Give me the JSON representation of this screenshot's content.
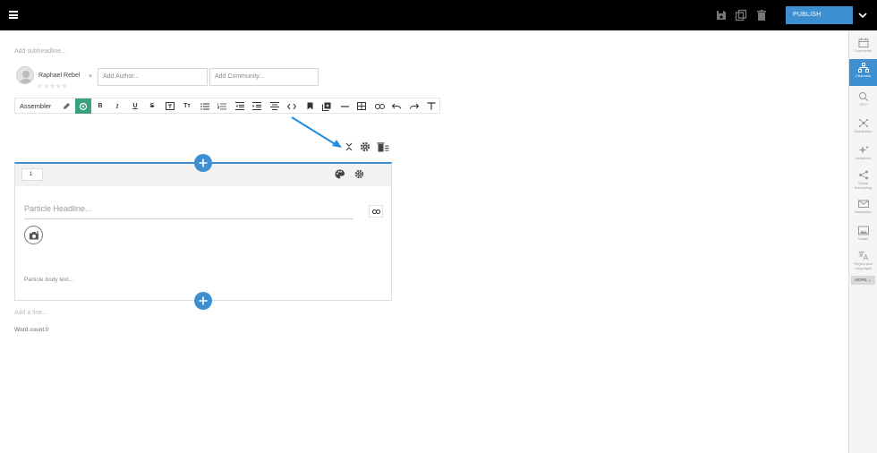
{
  "topbar": {
    "icons": [
      "menu-icon",
      "save-icon",
      "duplicate-icon",
      "delete-icon"
    ],
    "publish_label": "PUBLISH"
  },
  "editor": {
    "subheadline_placeholder": "Add subheadline...",
    "author": {
      "name": "Raphael Rebel",
      "rating": "☆☆☆☆☆",
      "remove": "×"
    },
    "add_author_placeholder": "Add Author...",
    "add_community_placeholder": "Add Community...",
    "toolbar": {
      "assembler_label": "Assembler",
      "buttons": [
        "bold",
        "italic",
        "underline",
        "strikethrough",
        "textbox",
        "text-size",
        "bullet-list",
        "numbered-list",
        "outdent",
        "indent",
        "align",
        "code",
        "bookmark",
        "embed",
        "horizontal-rule",
        "table",
        "link",
        "undo",
        "redo",
        "clear-format"
      ]
    },
    "particle": {
      "number": "1",
      "headline_placeholder": "Particle Headline...",
      "body_placeholder": "Particle body text..."
    },
    "add_line_placeholder": "Add a line...",
    "word_count": "Word count:0"
  },
  "sidebar": {
    "items": [
      {
        "label": "Comments",
        "icon": "calendar-icon"
      },
      {
        "label": "Channels",
        "icon": "channels-icon",
        "active": true
      },
      {
        "label": "SEO",
        "icon": "seo-icon"
      },
      {
        "label": "Distribution",
        "icon": "distribution-icon"
      },
      {
        "label": "Headlines",
        "icon": "sparkle-icon"
      },
      {
        "label": "Social Scheduling",
        "icon": "share-icon"
      },
      {
        "label": "Newsletter",
        "icon": "mail-icon"
      },
      {
        "label": "Teaser",
        "icon": "image-icon"
      },
      {
        "label": "Region and Languages",
        "icon": "translate-icon"
      }
    ],
    "more_label": "MORE ⌄"
  },
  "colors": {
    "accent": "#3d8fd1",
    "active_tool": "#3aa17a",
    "topbar": "#000000"
  }
}
